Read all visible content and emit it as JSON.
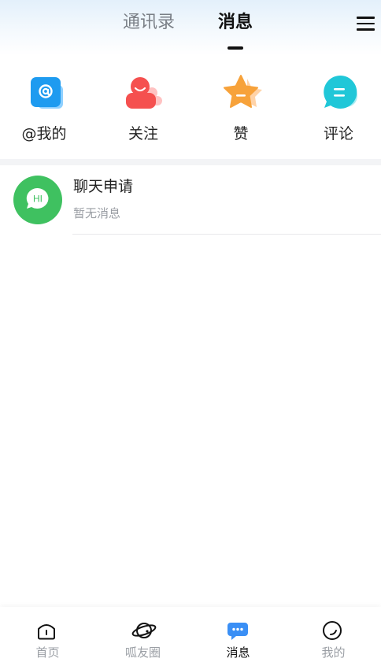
{
  "header": {
    "tabs": [
      {
        "label": "通讯录",
        "active": false
      },
      {
        "label": "消息",
        "active": true
      }
    ],
    "menu_icon": "hamburger-menu-icon"
  },
  "quick_actions": [
    {
      "label": "@我的",
      "icon": "at-mention-icon",
      "color": "#1e9bf0"
    },
    {
      "label": "关注",
      "icon": "person-follow-icon",
      "color": "#f5504f"
    },
    {
      "label": "赞",
      "icon": "star-like-icon",
      "color": "#f7a23a"
    },
    {
      "label": "评论",
      "icon": "comment-bubble-icon",
      "color": "#20c7d8"
    }
  ],
  "chat_requests": {
    "title": "聊天申请",
    "subtitle": "暂无消息",
    "avatar_icon": "hi-chat-icon",
    "avatar_text": "HI",
    "avatar_color": "#3fc160"
  },
  "bottom_nav": [
    {
      "label": "首页",
      "icon": "home-icon",
      "active": false
    },
    {
      "label": "呱友圈",
      "icon": "planet-icon",
      "active": false
    },
    {
      "label": "消息",
      "icon": "message-bubble-icon",
      "active": true
    },
    {
      "label": "我的",
      "icon": "profile-face-icon",
      "active": false
    }
  ],
  "colors": {
    "accent": "#3a8ff5",
    "inactive_text": "#9a9ea4",
    "divider": "#f3f4f6"
  }
}
